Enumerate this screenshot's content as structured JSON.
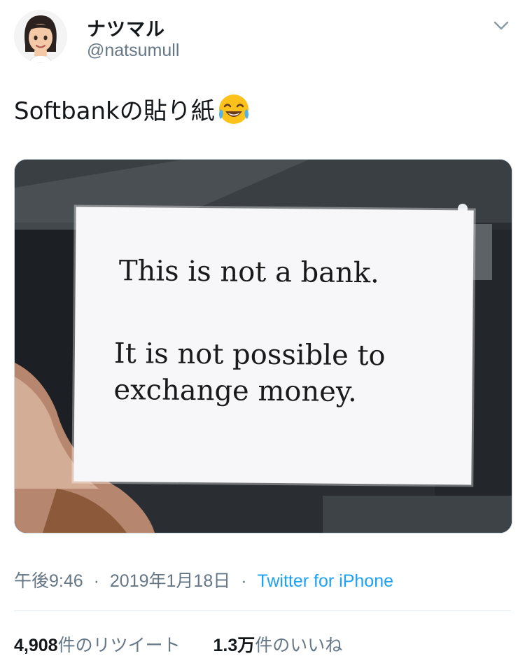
{
  "user": {
    "display_name": "ナツマル",
    "handle": "@natsumull"
  },
  "tweet": {
    "text": "Softbankの貼り紙",
    "emoji": "face-with-tears-of-joy",
    "image": {
      "sign_lines": [
        "This is not a bank.",
        "It is not possible to",
        "exchange money."
      ]
    }
  },
  "meta": {
    "time": "午後9:46",
    "separator": "·",
    "date": "2019年1月18日",
    "source": "Twitter for iPhone"
  },
  "stats": {
    "retweets_count": "4,908",
    "retweets_label": "件のリツイート",
    "likes_count": "1.3万",
    "likes_label": "件のいいね"
  },
  "colors": {
    "link": "#1da1f2",
    "secondary_text": "#657786",
    "primary_text": "#14171a"
  }
}
